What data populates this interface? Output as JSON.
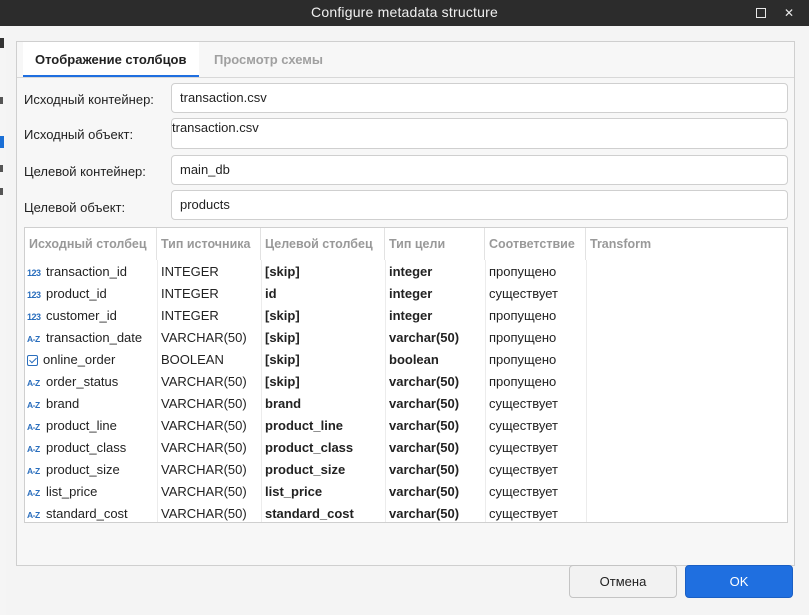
{
  "window": {
    "title": "Configure metadata structure"
  },
  "tabs": [
    {
      "label": "Отображение столбцов",
      "active": true
    },
    {
      "label": "Просмотр схемы",
      "active": false
    }
  ],
  "fields": {
    "source_container": {
      "label": "Исходный контейнер:",
      "value": "transaction.csv"
    },
    "source_object": {
      "label": "Исходный объект:",
      "value": "transaction.csv"
    },
    "target_container": {
      "label": "Целевой контейнер:",
      "value": "main_db"
    },
    "target_object": {
      "label": "Целевой объект:",
      "value": "products"
    }
  },
  "table": {
    "columns": [
      "Исходный столбец",
      "Тип источника",
      "Целевой столбец",
      "Тип цели",
      "Соответствие",
      "Transform"
    ],
    "rows": [
      {
        "icon": "number-icon",
        "icon_text": "123",
        "source": "transaction_id",
        "source_type": "INTEGER",
        "target": "[skip]",
        "target_type": "integer",
        "mapping": "пропущено",
        "transform": ""
      },
      {
        "icon": "number-icon",
        "icon_text": "123",
        "source": "product_id",
        "source_type": "INTEGER",
        "target": "id",
        "target_type": "integer",
        "mapping": "существует",
        "transform": ""
      },
      {
        "icon": "number-icon",
        "icon_text": "123",
        "source": "customer_id",
        "source_type": "INTEGER",
        "target": "[skip]",
        "target_type": "integer",
        "mapping": "пропущено",
        "transform": ""
      },
      {
        "icon": "text-icon",
        "icon_text": "A-Z",
        "source": "transaction_date",
        "source_type": "VARCHAR(50)",
        "target": "[skip]",
        "target_type": "varchar(50)",
        "mapping": "пропущено",
        "transform": ""
      },
      {
        "icon": "checkbox-icon",
        "icon_text": "",
        "source": "online_order",
        "source_type": "BOOLEAN",
        "target": "[skip]",
        "target_type": "boolean",
        "mapping": "пропущено",
        "transform": ""
      },
      {
        "icon": "text-icon",
        "icon_text": "A-Z",
        "source": "order_status",
        "source_type": "VARCHAR(50)",
        "target": "[skip]",
        "target_type": "varchar(50)",
        "mapping": "пропущено",
        "transform": ""
      },
      {
        "icon": "text-icon",
        "icon_text": "A-Z",
        "source": "brand",
        "source_type": "VARCHAR(50)",
        "target": "brand",
        "target_type": "varchar(50)",
        "mapping": "существует",
        "transform": ""
      },
      {
        "icon": "text-icon",
        "icon_text": "A-Z",
        "source": "product_line",
        "source_type": "VARCHAR(50)",
        "target": "product_line",
        "target_type": "varchar(50)",
        "mapping": "существует",
        "transform": ""
      },
      {
        "icon": "text-icon",
        "icon_text": "A-Z",
        "source": "product_class",
        "source_type": "VARCHAR(50)",
        "target": "product_class",
        "target_type": "varchar(50)",
        "mapping": "существует",
        "transform": ""
      },
      {
        "icon": "text-icon",
        "icon_text": "A-Z",
        "source": "product_size",
        "source_type": "VARCHAR(50)",
        "target": "product_size",
        "target_type": "varchar(50)",
        "mapping": "существует",
        "transform": ""
      },
      {
        "icon": "text-icon",
        "icon_text": "A-Z",
        "source": "list_price",
        "source_type": "VARCHAR(50)",
        "target": "list_price",
        "target_type": "varchar(50)",
        "mapping": "существует",
        "transform": ""
      },
      {
        "icon": "text-icon",
        "icon_text": "A-Z",
        "source": "standard_cost",
        "source_type": "VARCHAR(50)",
        "target": "standard_cost",
        "target_type": "varchar(50)",
        "mapping": "существует",
        "transform": ""
      }
    ]
  },
  "buttons": {
    "cancel": "Отмена",
    "ok": "OK"
  },
  "colors": {
    "accent": "#1f6fe0",
    "titlebar": "#2c2c2c",
    "icon": "#2a6ebd"
  }
}
